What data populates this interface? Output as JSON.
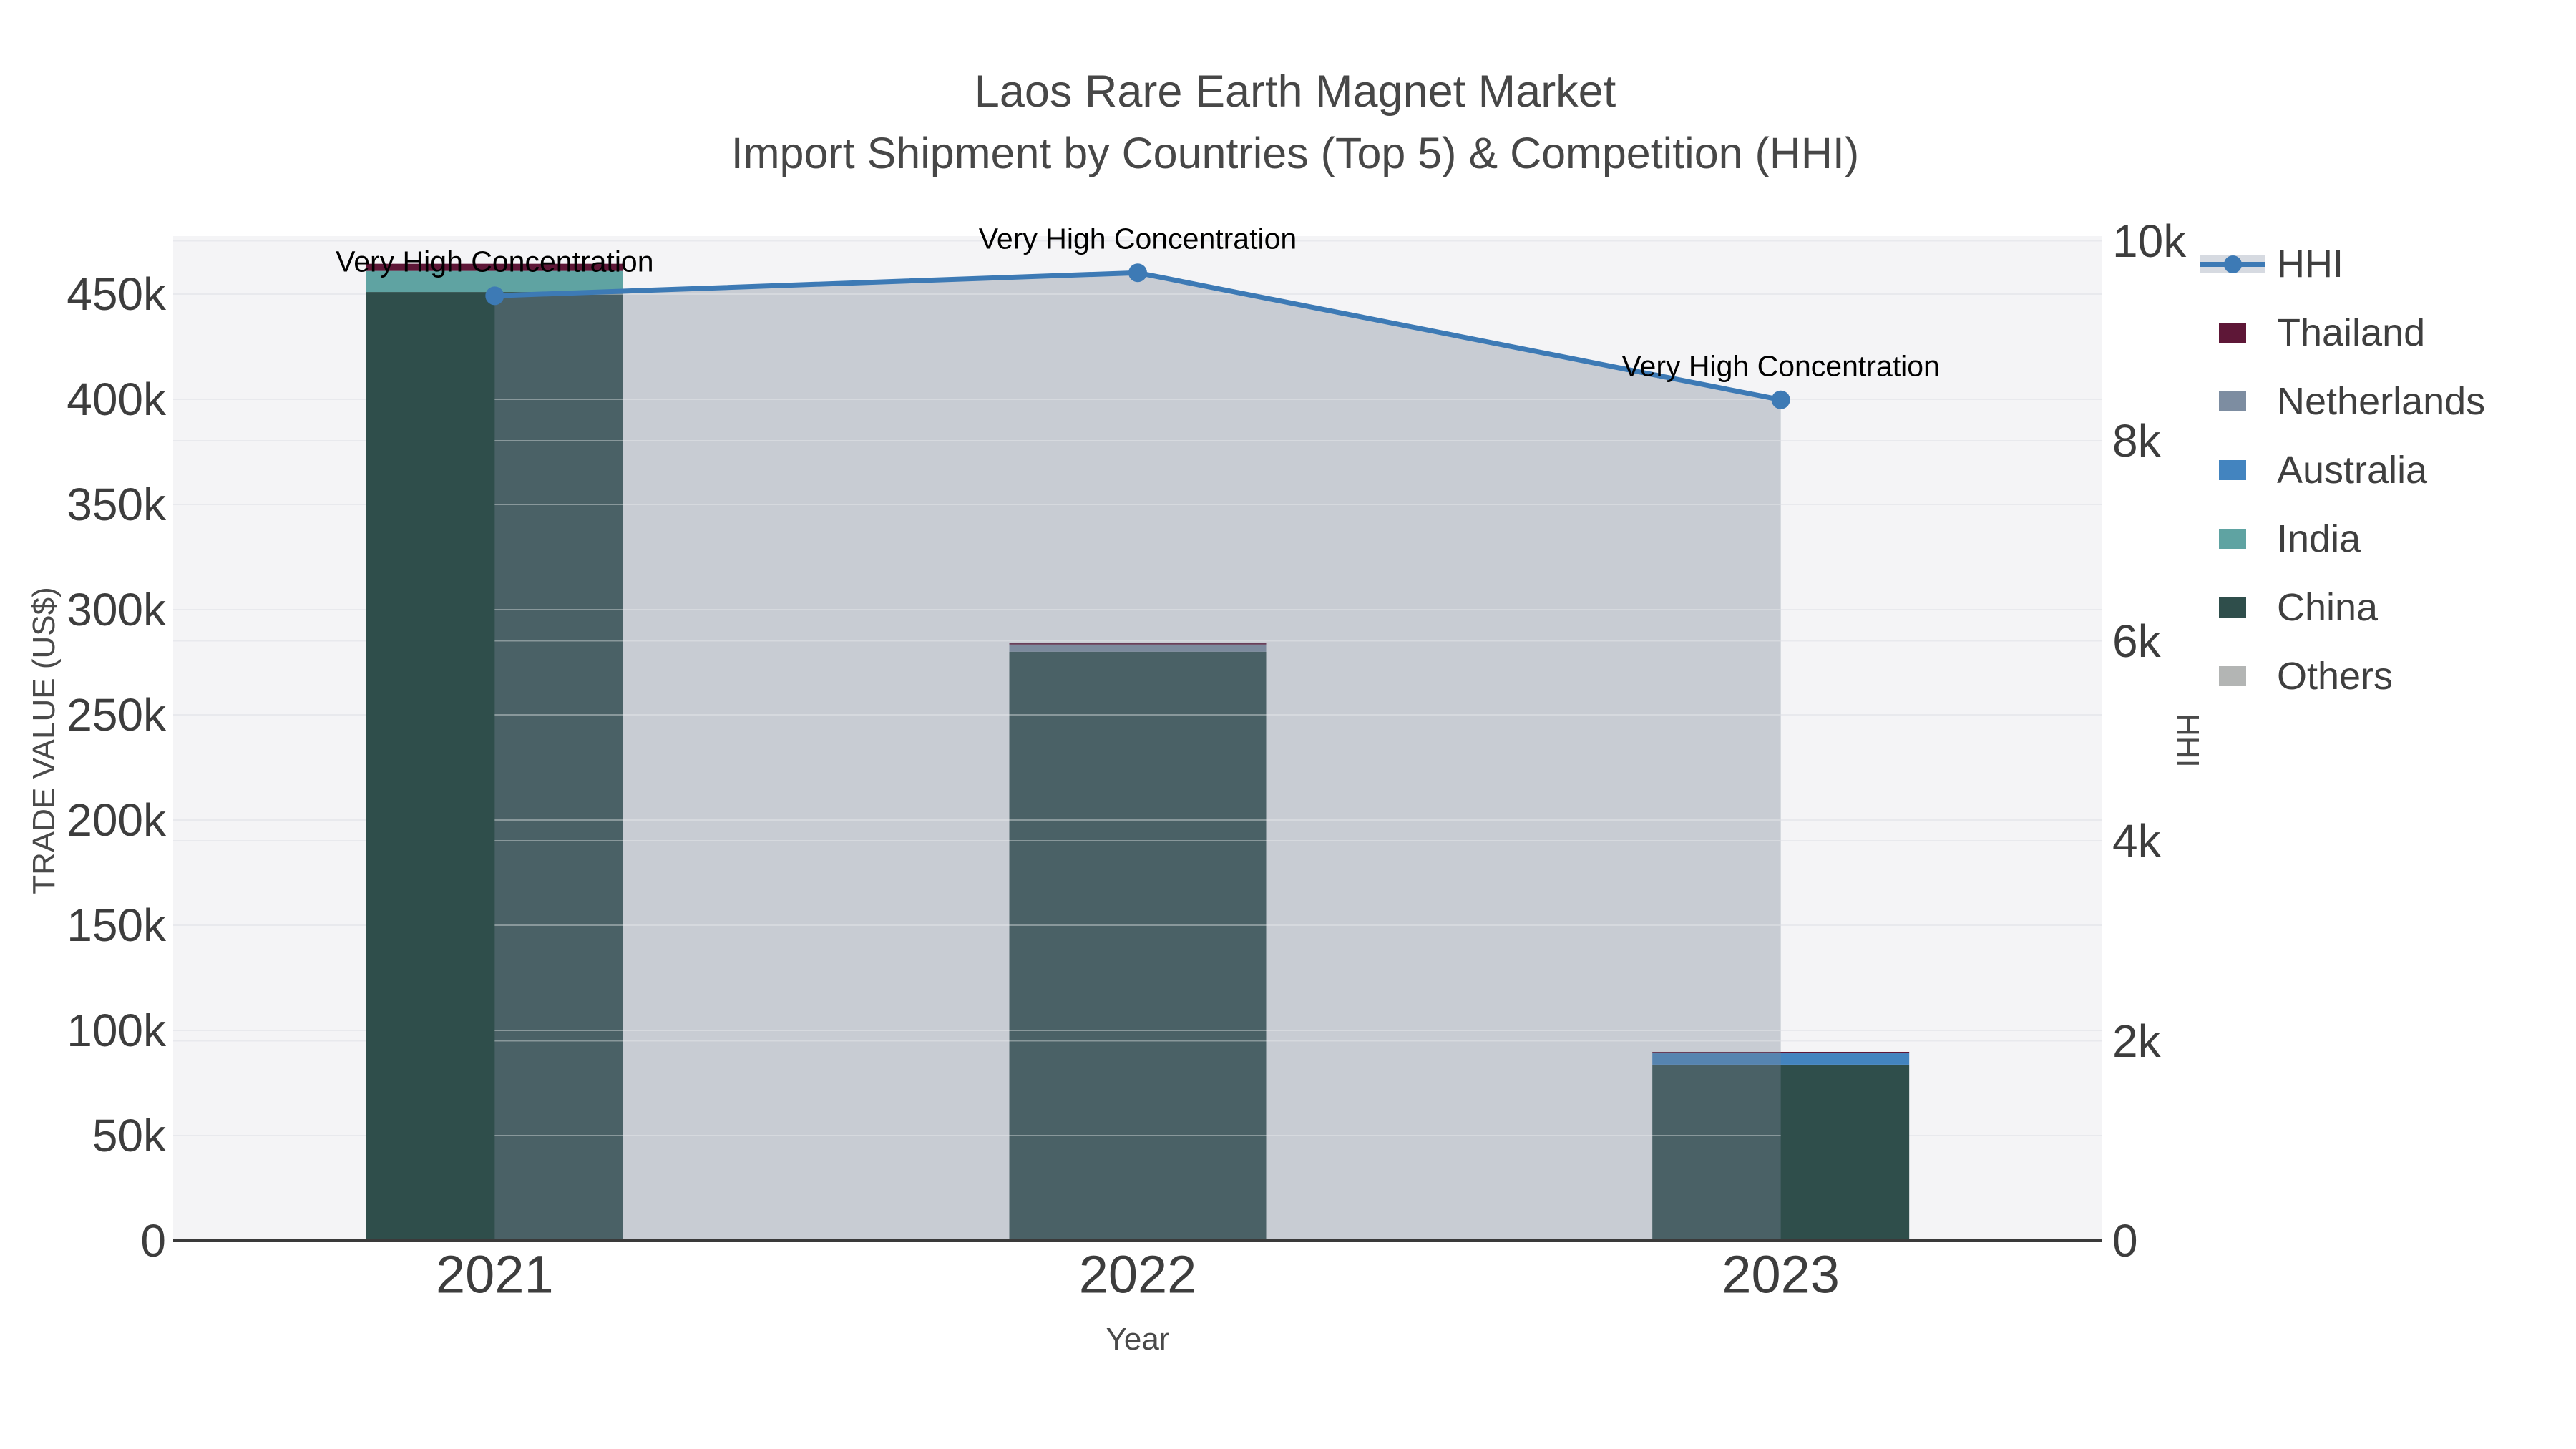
{
  "chart_data": {
    "type": "bar-line-combo",
    "title": "Laos Rare Earth Magnet Market",
    "subtitle": "Import Shipment by Countries (Top 5) & Competition (HHI)",
    "xlabel": "Year",
    "ylabel_left": "TRADE VALUE (US$)",
    "ylabel_right": "HHI",
    "categories": [
      "2021",
      "2022",
      "2023"
    ],
    "left_axis": {
      "tick_labels": [
        "0",
        "50k",
        "100k",
        "150k",
        "200k",
        "250k",
        "300k",
        "350k",
        "400k",
        "450k"
      ],
      "tick_values": [
        0,
        50000,
        100000,
        150000,
        200000,
        250000,
        300000,
        350000,
        400000,
        450000
      ],
      "range": [
        0,
        478000
      ]
    },
    "right_axis": {
      "tick_labels": [
        "0",
        "2k",
        "4k",
        "6k",
        "8k",
        "10k"
      ],
      "tick_values": [
        0,
        2000,
        4000,
        6000,
        8000,
        10000
      ],
      "range": [
        0,
        10060
      ]
    },
    "bar_series": [
      {
        "name": "Others",
        "color": "#b3b5b4",
        "values": [
          0,
          0,
          0
        ]
      },
      {
        "name": "China",
        "color": "#2f4e4b",
        "values": [
          451000,
          280000,
          83700
        ]
      },
      {
        "name": "India",
        "color": "#5fa3a2",
        "values": [
          10000,
          0,
          0
        ]
      },
      {
        "name": "Australia",
        "color": "#4384bf",
        "values": [
          0,
          0,
          5400
        ]
      },
      {
        "name": "Netherlands",
        "color": "#7d8da1",
        "values": [
          0,
          3400,
          0
        ]
      },
      {
        "name": "Thailand",
        "color": "#5e1737",
        "values": [
          3400,
          700,
          700
        ]
      }
    ],
    "bar_totals": [
      464400,
      284100,
      89800
    ],
    "line_series": {
      "name": "HHI",
      "color": "#3d7ab5",
      "fill": "rgba(122,133,150,0.36)",
      "values": [
        9450,
        9680,
        8410
      ]
    },
    "annotations": [
      {
        "text": "Very High Concentration",
        "category": "2021"
      },
      {
        "text": "Very High Concentration",
        "category": "2022"
      },
      {
        "text": "Very High Concentration",
        "category": "2023"
      }
    ],
    "legend_items": [
      {
        "label": "HHI",
        "type": "line",
        "color": "#3d7ab5",
        "band_color": "#d6dae1"
      },
      {
        "label": "Thailand",
        "type": "swatch",
        "color": "#5e1737"
      },
      {
        "label": "Netherlands",
        "type": "swatch",
        "color": "#7d8da1"
      },
      {
        "label": "Australia",
        "type": "swatch",
        "color": "#4384bf"
      },
      {
        "label": "India",
        "type": "swatch",
        "color": "#5fa3a2"
      },
      {
        "label": "China",
        "type": "swatch",
        "color": "#2f4e4b"
      },
      {
        "label": "Others",
        "type": "swatch",
        "color": "#b3b5b4"
      }
    ],
    "plot_bgcolor": "#f4f4f6",
    "paper_bgcolor": "#ffffff",
    "gridcolor": "#e8e9ed",
    "axisline_color": "#3a3a3a",
    "grid": true,
    "legend_position": "top-right-outside"
  }
}
